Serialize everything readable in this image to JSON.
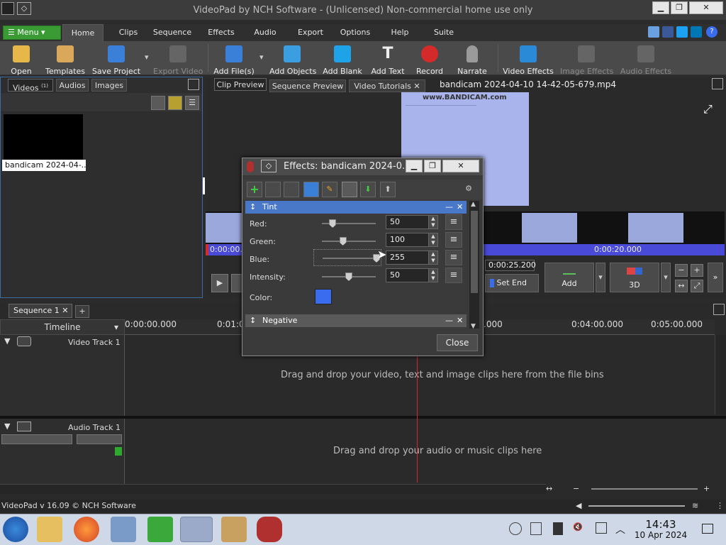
{
  "window": {
    "title": "VideoPad by NCH Software - (Unlicensed) Non-commercial home use only"
  },
  "menu": {
    "green_label": "Menu",
    "tabs": [
      "Home",
      "Clips",
      "Sequence",
      "Effects",
      "Audio",
      "Export",
      "Options",
      "Help",
      "Suite"
    ]
  },
  "ribbon": {
    "open": "Open",
    "templates": "Templates",
    "save_project": "Save Project",
    "export_video": "Export Video",
    "add_files": "Add File(s)",
    "add_objects": "Add Objects",
    "add_blank": "Add Blank",
    "add_text": "Add Text",
    "record": "Record",
    "narrate": "Narrate",
    "video_effects": "Video Effects",
    "image_effects": "Image Effects",
    "audio_effects": "Audio Effects"
  },
  "bin": {
    "tabs": [
      "Videos",
      "Audios",
      "Images"
    ],
    "videos_count": "(1)",
    "clip_label": "bandicam 2024-04-..."
  },
  "preview": {
    "tabs": [
      "Clip Preview",
      "Sequence Preview",
      "Video Tutorials"
    ],
    "filename": "bandicam 2024-04-10 14-42-05-679.mp4",
    "start_time": "0:00:00.0",
    "mid_time": "0:00:20.000",
    "end_time": "0:00:25.200",
    "set_end": "Set End",
    "add": "Add",
    "three_d": "3D",
    "watermark": "www.BANDICAM.com"
  },
  "dialog": {
    "title": "Effects: bandicam 2024-0...",
    "tint": {
      "header": "Tint",
      "red_label": "Red:",
      "red": "50",
      "red_level": 0.2,
      "green_label": "Green:",
      "green": "100",
      "green_level": 0.39,
      "blue_label": "Blue:",
      "blue": "255",
      "blue_level": 1.0,
      "intensity_label": "Intensity:",
      "intensity": "50",
      "intensity_level": 0.5,
      "color_label": "Color:",
      "color": "#3a6cf0"
    },
    "negative": {
      "header": "Negative"
    },
    "close": "Close"
  },
  "timeline": {
    "sequence_tab": "Sequence 1",
    "timeline_label": "Timeline",
    "ruler": [
      "0:00:00.000",
      "0:01:0",
      "0:04:00.000",
      "0:05:00.000"
    ],
    "ruler_mid": ".000",
    "video_track": "Video Track 1",
    "audio_track": "Audio Track 1",
    "video_drop": "Drag and drop your video, text and image clips here from the file bins",
    "audio_drop": "Drag and drop your audio or music clips here"
  },
  "status": {
    "version": "VideoPad v 16.09 © NCH Software"
  },
  "taskbar": {
    "time": "14:43",
    "date": "10 Apr 2024"
  }
}
